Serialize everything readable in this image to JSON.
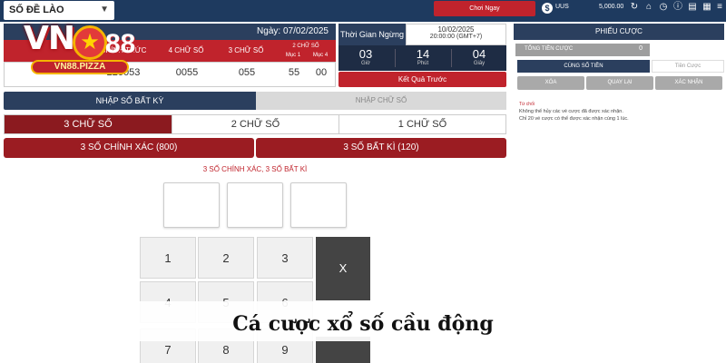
{
  "topbar": {
    "game_select": "SỐ ĐỀ LÀO",
    "play_now": "Chơi Ngay",
    "currency_code": "UUS",
    "balance": "5,000.00"
  },
  "logo": {
    "brand": "VN",
    "brand_num": "88",
    "sub": "VN88.PIZZA"
  },
  "draw": {
    "date_label": "Ngày: 07/02/2025",
    "columns": [
      "CHÍNH THỨC",
      "4 CHỮ SỐ",
      "3 CHỮ SỐ",
      "2 CHỮ SỐ"
    ],
    "sub_columns": [
      "Mục 1",
      "Mục 4"
    ],
    "values": [
      "220053",
      "0055",
      "055",
      "55",
      "00"
    ]
  },
  "countdown": {
    "label": "Thời Gian Ngừng",
    "date": "10/02/2025",
    "time": "20:00:00 (GMT+7)",
    "hours": "03",
    "hours_unit": "Giờ",
    "minutes": "14",
    "minutes_unit": "Phút",
    "seconds": "04",
    "seconds_unit": "Giây",
    "prev_result": "Kết Quả Trước"
  },
  "modes": {
    "active": "NHẬP SỐ BẤT KỲ",
    "inactive": "NHẬP CHỮ SỐ"
  },
  "digit_tabs": [
    "3 CHỮ SỐ",
    "2 CHỮ SỐ",
    "1 CHỮ SỐ"
  ],
  "type_tabs": [
    "3 SỐ CHÍNH XÁC (800)",
    "3 SỐ BẤT KÌ (120)"
  ],
  "hint": "3 SỐ CHÍNH XÁC, 3 SỐ BẤT KÌ",
  "keypad": {
    "k1": "1",
    "k2": "2",
    "k3": "3",
    "k4": "4",
    "k5": "5",
    "k6": "6",
    "k7": "7",
    "k8": "8",
    "k9": "9",
    "clear": "X"
  },
  "slip": {
    "title": "PHIẾU CƯỢC",
    "total_label": "TỔNG TIỀN CƯỢC",
    "total_value": "0",
    "same_money": "CÙNG SỐ TIỀN",
    "stake_placeholder": "Tiền Cược",
    "btn_clear": "XÓA",
    "btn_back": "QUAY LẠI",
    "btn_confirm": "XÁC NHẬN",
    "note_title": "Từ chối",
    "note1": "Không thể hủy các vé cược đã được xác nhận.",
    "note2": "Chỉ 20 vé cược có thể được xác nhận cùng 1 lúc."
  },
  "caption": "Cá cược xổ số cầu động",
  "colors": {
    "navy": "#2b3f5e",
    "red": "#c0232c",
    "dark_red": "#8b1a1f"
  }
}
